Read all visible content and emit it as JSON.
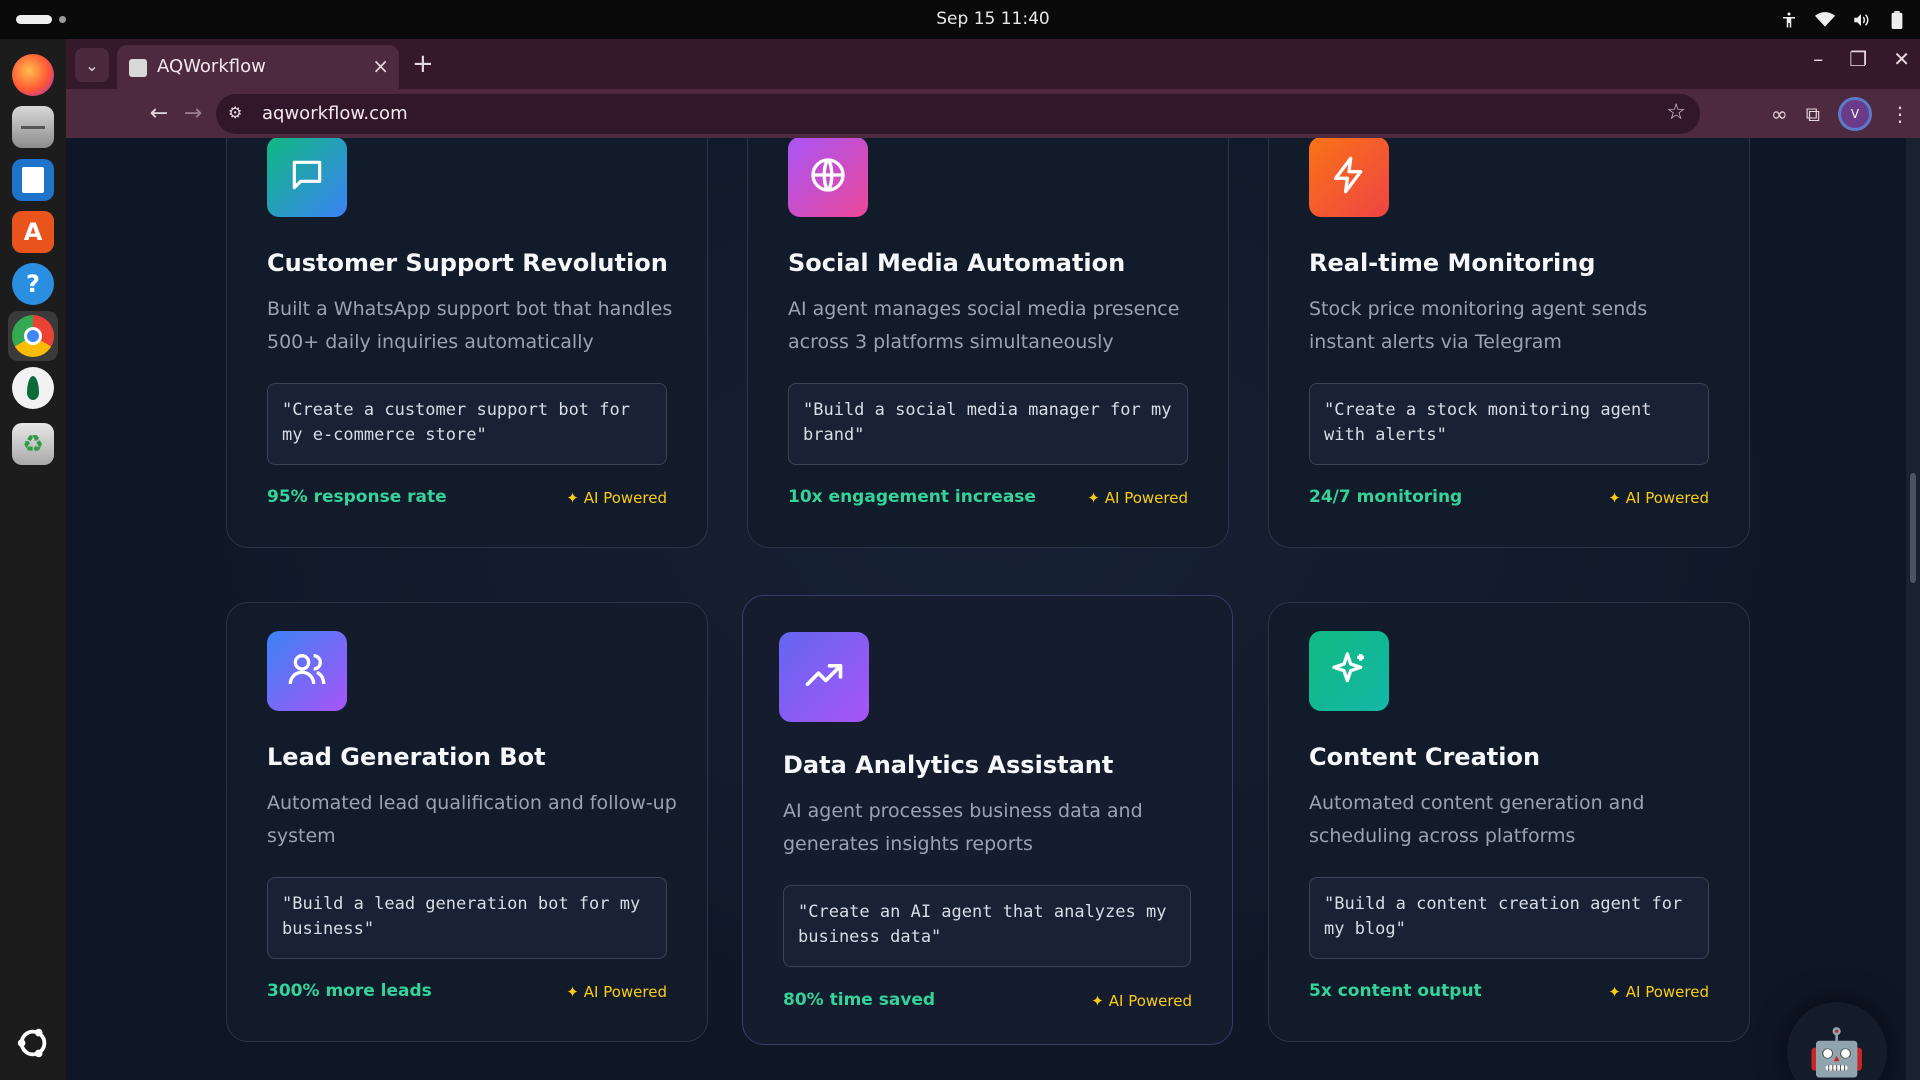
{
  "os": {
    "clock": "Sep 15  11:40"
  },
  "browser": {
    "tab_title": "AQWorkflow",
    "url": "aqworkflow.com",
    "profile_initial": "V"
  },
  "cards": [
    {
      "title": "Customer Support Revolution",
      "description": "Built a WhatsApp support bot that handles 500+ daily inquiries automatically",
      "prompt": "\"Create a customer support bot for my e-commerce store\"",
      "metric": "95% response rate",
      "badge": "AI Powered",
      "icon": "chat-bubble-icon",
      "gradient": [
        "#10b981",
        "#3b82f6"
      ]
    },
    {
      "title": "Social Media Automation",
      "description": "AI agent manages social media presence across 3 platforms simultaneously",
      "prompt": "\"Build a social media manager for my brand\"",
      "metric": "10x engagement increase",
      "badge": "AI Powered",
      "icon": "globe-icon",
      "gradient": [
        "#a855f7",
        "#ec4899"
      ]
    },
    {
      "title": "Real-time Monitoring",
      "description": "Stock price monitoring agent sends instant alerts via Telegram",
      "prompt": "\"Create a stock monitoring agent with alerts\"",
      "metric": "24/7 monitoring",
      "badge": "AI Powered",
      "icon": "lightning-icon",
      "gradient": [
        "#f97316",
        "#ef4444"
      ]
    },
    {
      "title": "Lead Generation Bot",
      "description": "Automated lead qualification and follow-up system",
      "prompt": "\"Build a lead generation bot for my business\"",
      "metric": "300% more leads",
      "badge": "AI Powered",
      "icon": "users-icon",
      "gradient": [
        "#3b82f6",
        "#a855f7"
      ]
    },
    {
      "title": "Data Analytics Assistant",
      "description": "AI agent processes business data and generates insights reports",
      "prompt": "\"Create an AI agent that analyzes my business data\"",
      "metric": "80% time saved",
      "badge": "AI Powered",
      "icon": "trending-up-icon",
      "gradient": [
        "#6366f1",
        "#a855f7"
      ]
    },
    {
      "title": "Content Creation",
      "description": "Automated content generation and scheduling across platforms",
      "prompt": "\"Build a content creation agent for my blog\"",
      "metric": "5x content output",
      "badge": "AI Powered",
      "icon": "sparkles-icon",
      "gradient": [
        "#10b981",
        "#14b8a6"
      ]
    }
  ],
  "colors": {
    "metric": "#34d399",
    "badge": "#facc15",
    "prompt_text": "#d8dce5"
  }
}
